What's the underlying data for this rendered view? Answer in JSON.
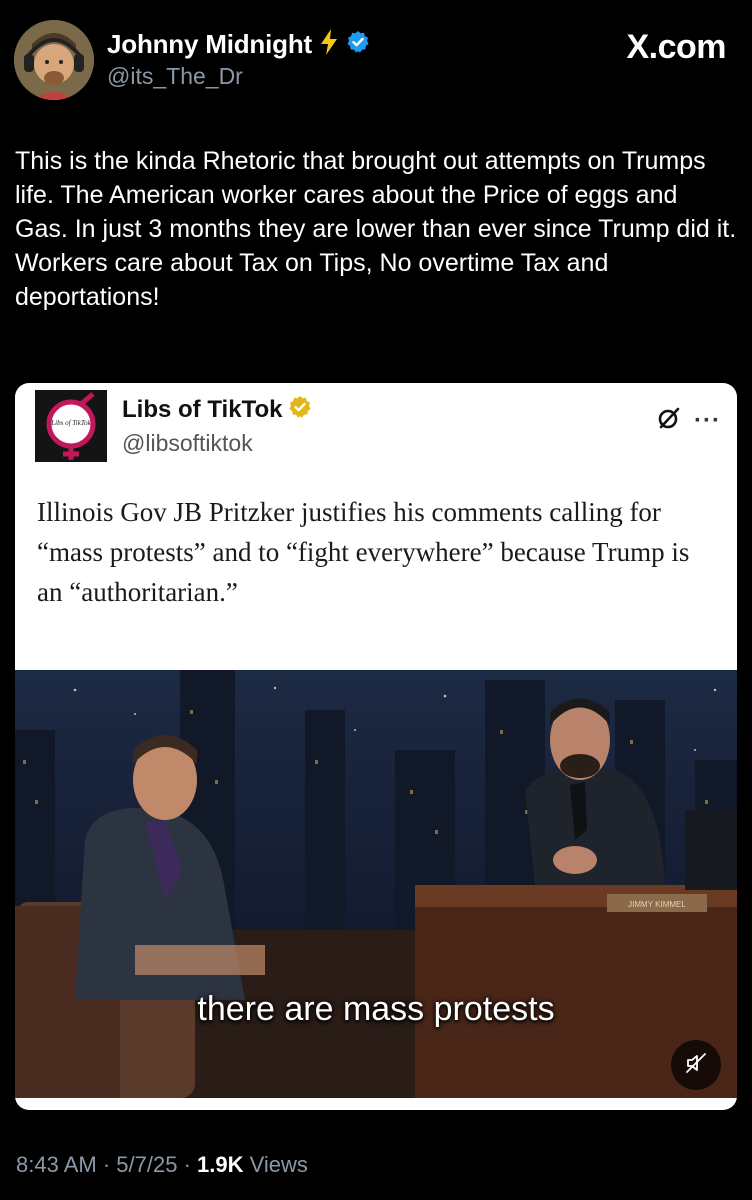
{
  "post": {
    "author_name": "Johnny Midnight",
    "author_handle": "@its_The_Dr",
    "site": "X.com",
    "text": "This is the kinda Rhetoric that brought out attempts on Trumps life. The American worker cares about the Price of eggs and Gas. In just 3 months they are lower than ever since Trump did it. Workers care about Tax on Tips, No overtime Tax and deportations!",
    "badges": [
      "lightning-icon",
      "verified-icon"
    ]
  },
  "quoted": {
    "author_name": "Libs of TikTok",
    "author_handle": "@libsoftiktok",
    "avatar_text": "Libs of TikTok",
    "more_label": "···",
    "text": "Illinois Gov JB Pritzker justifies his comments calling for “mass protests” and to “fight everywhere” because Trump is an “authoritarian.”",
    "video_caption": "there are mass protests",
    "video_desk_plate": "JIMMY KIMMEL"
  },
  "footer": {
    "time": "8:43 AM",
    "sep1": " · ",
    "date": "5/7/25",
    "sep2": " · ",
    "views_count": "1.9K",
    "views_label": " Views"
  },
  "colors": {
    "background": "#000000",
    "verified_blue": "#1d9bf0",
    "gold_badge": "#e2b719",
    "muted_text": "#8b98a5"
  }
}
